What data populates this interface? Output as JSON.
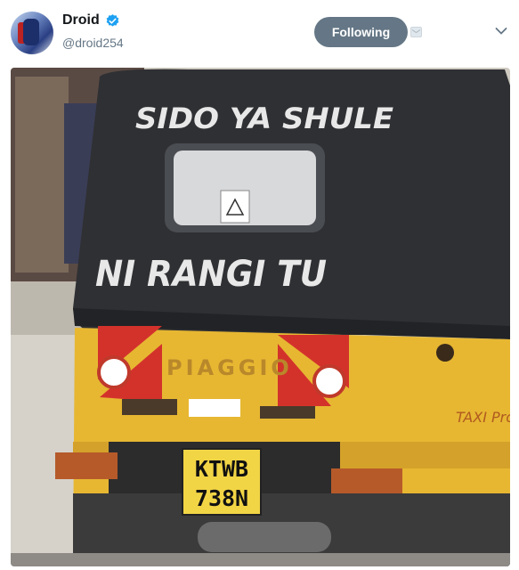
{
  "tweet": {
    "author": {
      "display_name": "Droid",
      "handle": "@droid254",
      "verified": true
    },
    "follow_button_label": "Following",
    "photo": {
      "top_text": "SIDO YA SHULE",
      "bottom_text": "NI RANGI TU",
      "plate_line1": "KTWB",
      "plate_line2": "738N",
      "brand": "PIAGGIO",
      "badge": "TAXI Pro"
    }
  },
  "colors": {
    "follow_bg": "#657786",
    "verified": "#1da1f2",
    "tuk_yellow": "#e7b732"
  },
  "icons": [
    "avatar",
    "verified-badge-icon",
    "dm-icon",
    "chevron-down-icon"
  ]
}
